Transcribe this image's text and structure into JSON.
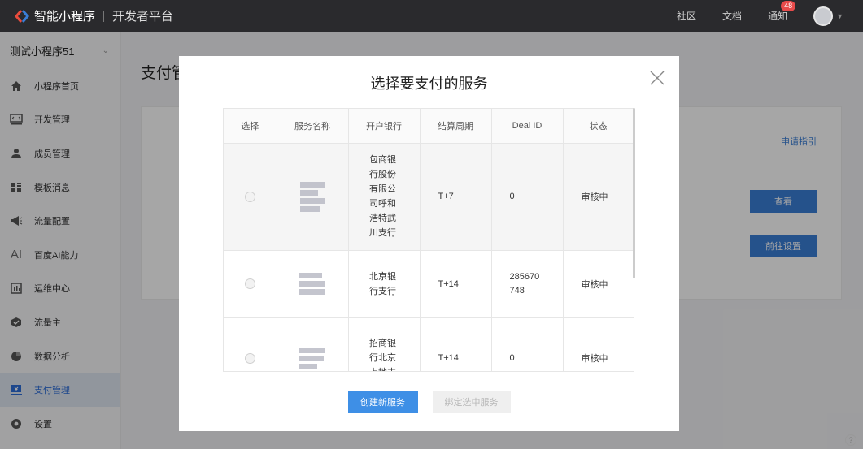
{
  "topbar": {
    "brand": "智能小程序",
    "platform": "开发者平台",
    "nav": [
      {
        "label": "社区"
      },
      {
        "label": "文档"
      },
      {
        "label": "通知",
        "badge": "48"
      }
    ]
  },
  "sidebar": {
    "app_name": "测试小程序51",
    "items": [
      {
        "label": "小程序首页",
        "icon": "home-icon"
      },
      {
        "label": "开发管理",
        "icon": "code-icon"
      },
      {
        "label": "成员管理",
        "icon": "user-icon"
      },
      {
        "label": "模板消息",
        "icon": "template-icon"
      },
      {
        "label": "流量配置",
        "icon": "megaphone-icon"
      },
      {
        "label": "百度AI能力",
        "icon": "ai-icon"
      },
      {
        "label": "运维中心",
        "icon": "chart-bar-icon"
      },
      {
        "label": "流量主",
        "icon": "hexagon-icon"
      },
      {
        "label": "数据分析",
        "icon": "pie-chart-icon"
      },
      {
        "label": "支付管理",
        "icon": "payment-icon",
        "active": true
      },
      {
        "label": "设置",
        "icon": "settings-icon"
      }
    ]
  },
  "main": {
    "title": "支付管",
    "card": {
      "guide": "申请指引",
      "view_button": "查看",
      "setup_button": "前往设置"
    }
  },
  "modal": {
    "title": "选择要支付的服务",
    "columns": [
      "选择",
      "服务名称",
      "开户银行",
      "结算周期",
      "Deal ID",
      "状态"
    ],
    "rows": [
      {
        "bank": "包商银行股份有限公司呼和浩特武川支行",
        "cycle": "T+7",
        "deal_id": "0",
        "status": "审核中"
      },
      {
        "bank": "北京银行支行",
        "cycle": "T+14",
        "deal_id": "285670748",
        "status": "审核中"
      },
      {
        "bank": "招商银行北京上地支",
        "cycle": "T+14",
        "deal_id": "0",
        "status": "审核中"
      }
    ],
    "create_button": "创建新服务",
    "bind_button": "绑定选中服务"
  },
  "colors": {
    "topbar": "#2a2a2d",
    "accent": "#3a7ed6",
    "badge": "#e84b4b"
  }
}
